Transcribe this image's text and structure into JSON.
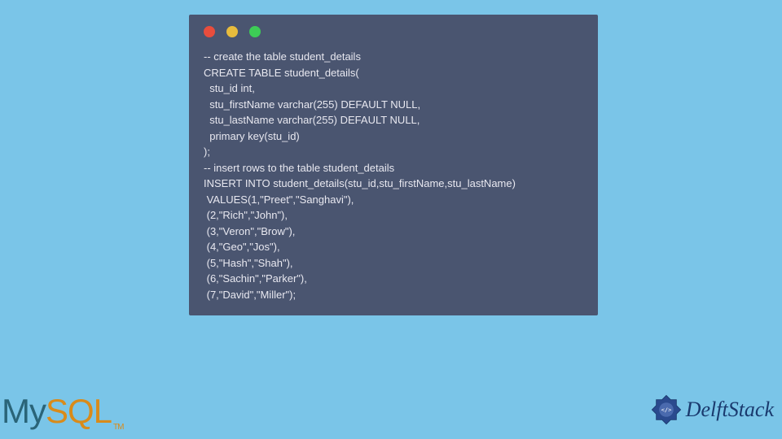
{
  "code": {
    "lines": [
      "-- create the table student_details",
      "CREATE TABLE student_details(",
      "  stu_id int,",
      "  stu_firstName varchar(255) DEFAULT NULL,",
      "  stu_lastName varchar(255) DEFAULT NULL,",
      "  primary key(stu_id)",
      ");",
      "-- insert rows to the table student_details",
      "INSERT INTO student_details(stu_id,stu_firstName,stu_lastName)",
      " VALUES(1,\"Preet\",\"Sanghavi\"),",
      " (2,\"Rich\",\"John\"),",
      " (3,\"Veron\",\"Brow\"),",
      " (4,\"Geo\",\"Jos\"),",
      " (5,\"Hash\",\"Shah\"),",
      " (6,\"Sachin\",\"Parker\"),",
      " (7,\"David\",\"Miller\");"
    ]
  },
  "logos": {
    "mysql_my": "My",
    "mysql_sql": "SQL",
    "mysql_tm": "TM",
    "delftstack": "DelftStack"
  }
}
